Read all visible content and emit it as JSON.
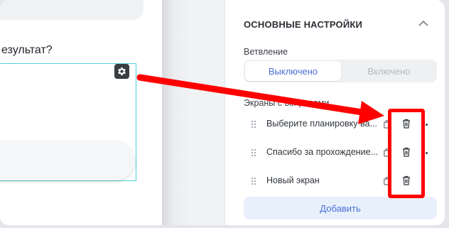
{
  "canvas": {
    "question_title": "езультат?"
  },
  "settings": {
    "title": "ОСНОВНЫЕ НАСТРОЙКИ",
    "branching": {
      "label": "Ветвление",
      "options": [
        "Выключено",
        "Включено"
      ],
      "selected": "Выключено"
    },
    "screens": {
      "label": "Экраны с вопросами",
      "items": [
        {
          "label": "Выберите планировку ва..."
        },
        {
          "label": "Спасибо за прохождение..."
        },
        {
          "label": "Новый экран"
        }
      ]
    },
    "add_label": "Добавить"
  },
  "colors": {
    "accent": "#4a6fd4",
    "annotation": "#ff0000",
    "selection_border": "#4fd0d8"
  },
  "icons": [
    "gear-icon",
    "chevron-up-icon",
    "drag-handle-icon",
    "copy-icon",
    "trash-icon",
    "more-icon"
  ]
}
